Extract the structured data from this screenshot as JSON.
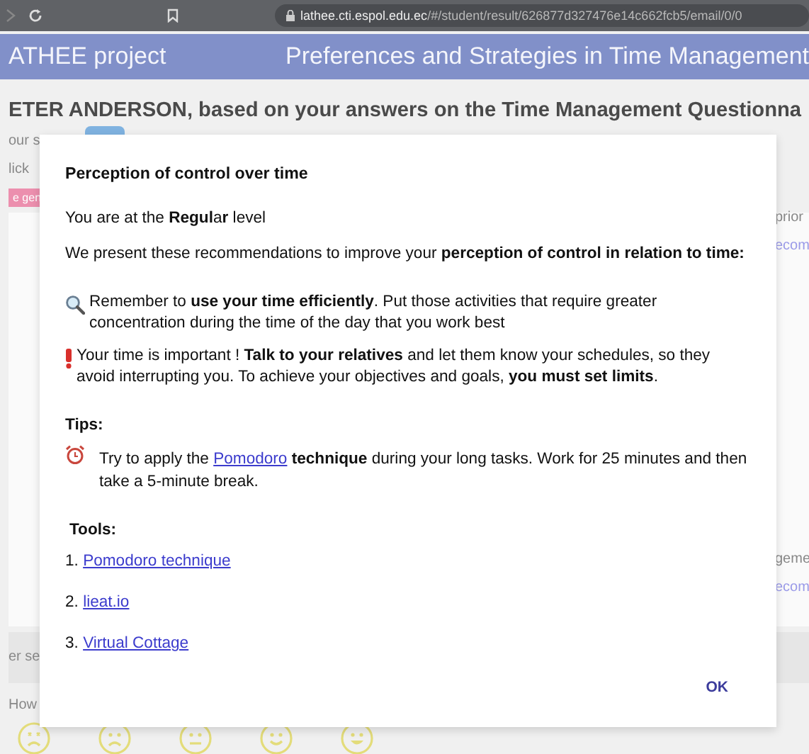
{
  "browser": {
    "host": "lathee.cti.espol.edu.ec",
    "path": "/#/student/result/626877d327476e14c662fcb5/email/0/0"
  },
  "header": {
    "brand": "ATHEE project",
    "title": "Preferences and Strategies in Time Management"
  },
  "page": {
    "heading": "ETER ANDERSON, based on your answers on the Time Management Questionna",
    "left_texts": [
      "our s",
      "lick"
    ],
    "badge": "e gen",
    "right_texts": [
      "prior",
      "ecom"
    ],
    "right_texts_lower": [
      "geme",
      "ecom"
    ],
    "section_text": "er se",
    "question": "How",
    "rating": [
      {
        "kind": "very_sad"
      },
      {
        "kind": "sad"
      },
      {
        "kind": "neutral"
      },
      {
        "kind": "happy"
      },
      {
        "kind": "very_happy"
      }
    ]
  },
  "dialog": {
    "title": "Perception of control over time",
    "level_line": "You are at the **Regul**a**r** level",
    "intro": "We present these recommendations to improve your **perception of control in relation to time:**",
    "recommendations": [
      {
        "kind": "search",
        "text": "Remember to **use your time efficiently**. Put those activities that require greater concentration during the time of the day that you work best"
      },
      {
        "kind": "alert",
        "text": "Your time is important ! **Talk to your relatives** and let them know your schedules, so they avoid interrupting you. To achieve your objectives and goals, **you must set limits**."
      }
    ],
    "tips_heading": "Tips:",
    "tips": [
      {
        "kind": "alarm",
        "before": "Try to apply the ",
        "link": "Pomodoro",
        "after": " **technique** during your long tasks. Work for 25 minutes and then take a 5-minute break."
      }
    ],
    "tools_heading": "Tools:",
    "tools": [
      {
        "number": "1.",
        "label": "Pomodoro technique"
      },
      {
        "number": "2.",
        "label": "lieat.io"
      },
      {
        "number": "3.",
        "label": "Virtual Cottage"
      }
    ],
    "ok": "OK"
  }
}
